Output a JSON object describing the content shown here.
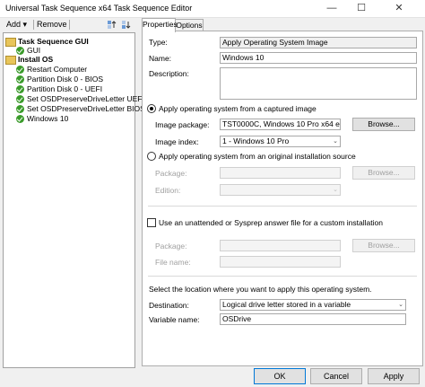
{
  "window": {
    "title": "Universal Task Sequence x64 Task Sequence Editor",
    "minimize": "—",
    "maximize": "☐",
    "close": "✕"
  },
  "toolbar": {
    "add": "Add",
    "add_caret": "▾",
    "remove": "Remove"
  },
  "tree": {
    "groups": [
      {
        "label": "Task Sequence GUI",
        "items": [
          "GUI"
        ]
      },
      {
        "label": "Install OS",
        "items": [
          "Restart Computer",
          "Partition Disk 0 - BIOS",
          "Partition Disk 0 - UEFI",
          "Set OSDPreserveDriveLetter UEFI",
          "Set OSDPreserveDriveLetter BIOS",
          "Windows 10"
        ]
      }
    ]
  },
  "tabs": [
    {
      "label": "Properties"
    },
    {
      "label": "Options"
    }
  ],
  "properties": {
    "type_label": "Type:",
    "type_value": "Apply Operating System Image",
    "name_label": "Name:",
    "name_value": "Windows 10",
    "description_label": "Description:",
    "description_value": "",
    "radio_captured": "Apply operating system from a captured image",
    "image_package_label": "Image package:",
    "image_package_value": "TST0000C, Windows 10 Pro x64 en-US",
    "image_index_label": "Image index:",
    "image_index_value": "1 - Windows 10 Pro",
    "browse": "Browse...",
    "radio_original": "Apply operating system from an original installation source",
    "package_label": "Package:",
    "edition_label": "Edition:",
    "unattend_checkbox": "Use an unattended or Sysprep answer file for a custom installation",
    "package2_label": "Package:",
    "filename_label": "File name:",
    "location_text": "Select the location where you want to apply this operating system.",
    "destination_label": "Destination:",
    "destination_value": "Logical drive letter stored in a variable",
    "variable_label": "Variable name:",
    "variable_value": "OSDrive",
    "dropdown_glyph": "⌄"
  },
  "buttons": {
    "ok": "OK",
    "cancel": "Cancel",
    "apply": "Apply"
  }
}
